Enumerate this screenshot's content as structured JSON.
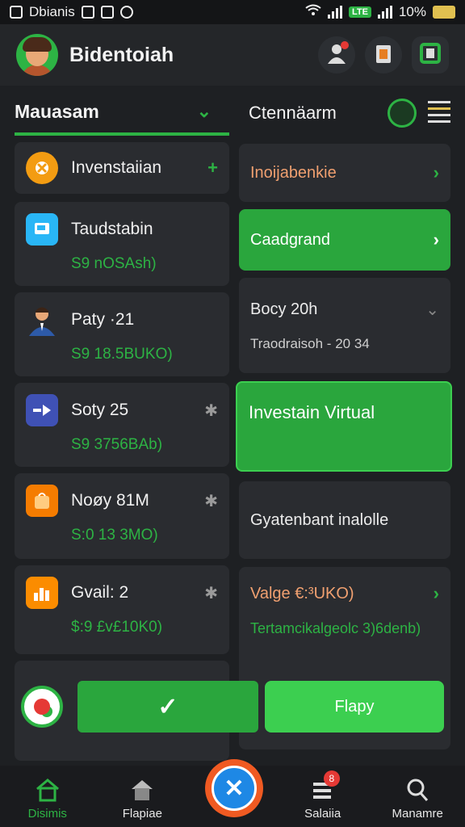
{
  "statusbar": {
    "left_text": "Dbianis",
    "battery_text": "10%"
  },
  "header": {
    "title": "Bidentoiah"
  },
  "left_column": {
    "title": "Mauasam",
    "cards": [
      {
        "title": "Invenstaiian",
        "sub": ""
      },
      {
        "title": "Taudstabin",
        "sub": "S9 nOSAsh)"
      },
      {
        "title": "Paty ·21",
        "sub": "S9 18.5BUKO)"
      },
      {
        "title": "Soty 25",
        "sub": "S9 3756BAb)"
      },
      {
        "title": "Noøy 81M",
        "sub": "S:0 13 3MO)"
      },
      {
        "title": "Gvail: 2",
        "sub": "$:9 £v£10K0)"
      }
    ]
  },
  "right_column": {
    "title": "Ctennäarm",
    "cards": [
      {
        "title": "Inoijabenkie"
      },
      {
        "title": "Caadgrand"
      },
      {
        "title": "Bocy 20h",
        "sub": "Traodraisoh - 20 34"
      },
      {
        "title": "Investain Virtual"
      },
      {
        "title": "Gyatenbant inalolle"
      },
      {
        "title": "Valge €:³UKO)",
        "sub": "Tertamcikalgeolc 3)6denb)"
      }
    ]
  },
  "actions": {
    "confirm_symbol": "✓",
    "flap_label": "Flapy"
  },
  "nav": {
    "items": [
      {
        "label": "Disimis"
      },
      {
        "label": "Flapiae"
      },
      {
        "label": "Salaiia",
        "badge": "8"
      },
      {
        "label": "Manamre"
      }
    ]
  },
  "colors": {
    "accent": "#2db344",
    "background": "#1e2023",
    "card": "#2a2c30"
  }
}
